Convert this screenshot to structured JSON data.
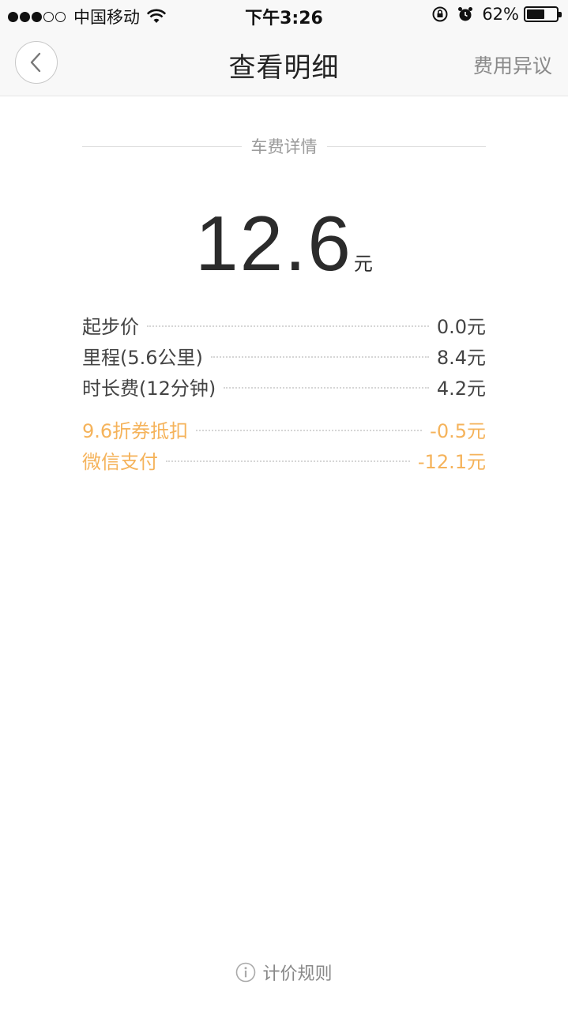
{
  "status_bar": {
    "carrier": "中国移动",
    "time": "下午3:26",
    "battery_percent": "62%",
    "signal_bars_filled": 3,
    "signal_bars_total": 5
  },
  "nav": {
    "title": "查看明细",
    "right_action": "费用异议",
    "back_icon": "chevron-left-icon"
  },
  "section": {
    "title": "车费详情"
  },
  "total": {
    "amount": "12.6",
    "unit": "元"
  },
  "fare_items": [
    {
      "label": "起步价",
      "value": "0.0元"
    },
    {
      "label": "里程(5.6公里)",
      "value": "8.4元"
    },
    {
      "label": "时长费(12分钟)",
      "value": "4.2元"
    }
  ],
  "deductions": [
    {
      "label": "9.6折券抵扣",
      "value": "-0.5元"
    },
    {
      "label": "微信支付",
      "value": "-12.1元"
    }
  ],
  "footer": {
    "label": "计价规则",
    "icon": "info-icon"
  },
  "colors": {
    "accent_orange": "#f5b35b",
    "nav_bg": "#f8f8f8"
  }
}
